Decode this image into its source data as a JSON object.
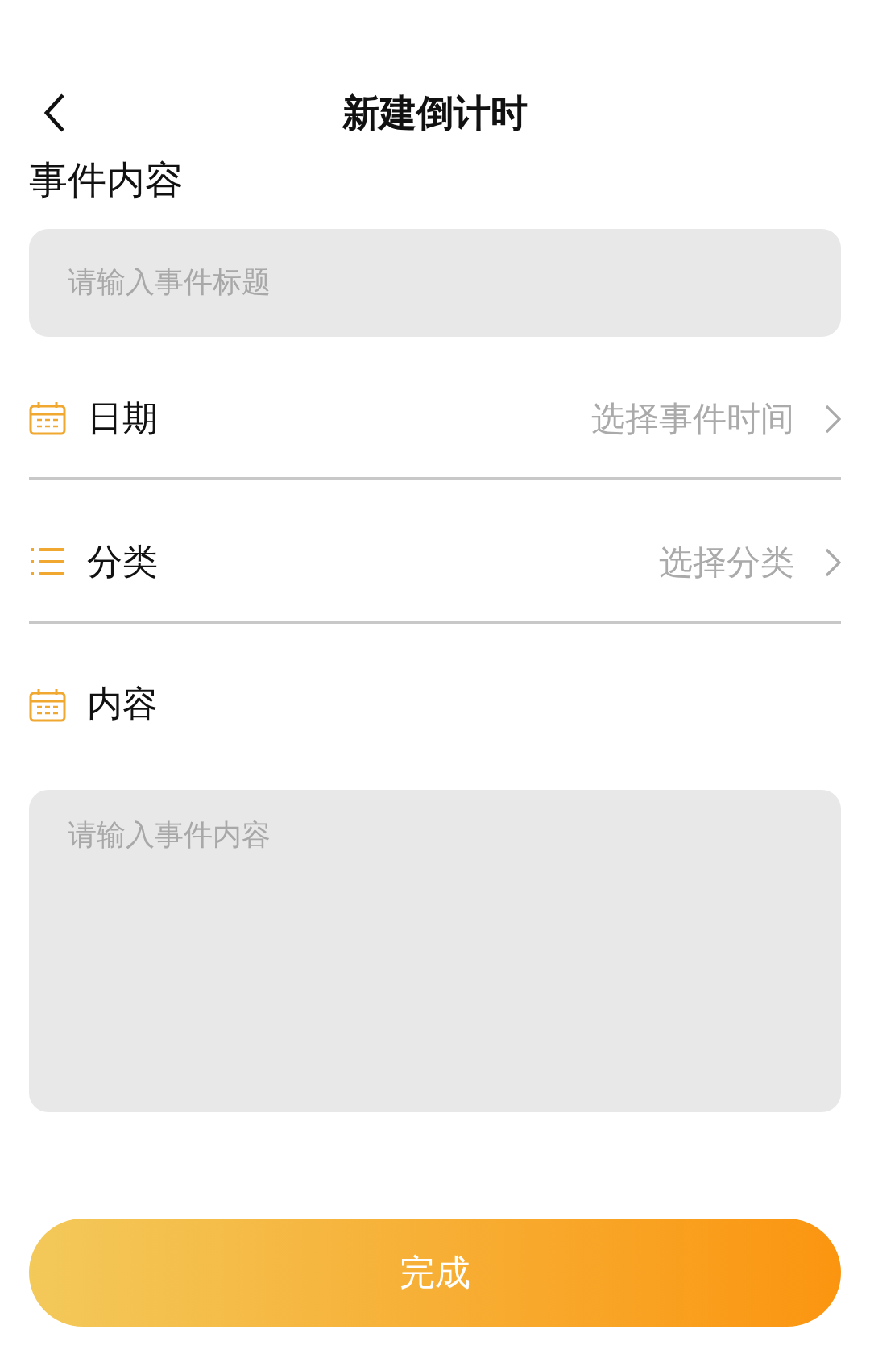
{
  "header": {
    "title": "新建倒计时"
  },
  "section_title": "事件内容",
  "title_field": {
    "placeholder": "请输入事件标题"
  },
  "rows": [
    {
      "kind": "picker",
      "label": "日期",
      "value": "选择事件时间"
    },
    {
      "kind": "picker",
      "label": "分类",
      "value": "选择分类"
    },
    {
      "kind": "heading",
      "label": "内容"
    }
  ],
  "content_field": {
    "placeholder": "请输入事件内容"
  },
  "submit": "完成"
}
